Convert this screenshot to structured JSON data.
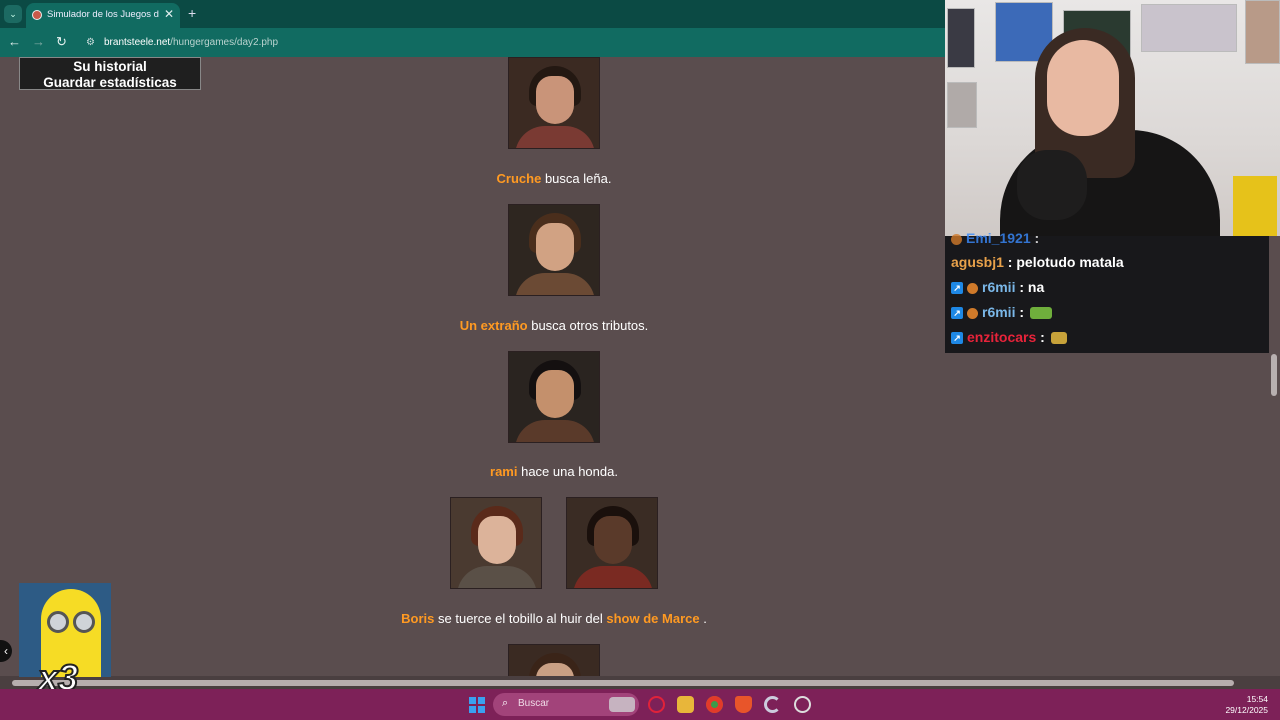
{
  "browser": {
    "tab_title": "Simulador de los Juegos del Ha",
    "tab_close": "✕",
    "new_tab": "+",
    "url_host": "brantsteele.net",
    "url_path": "/hungergames/day2.php"
  },
  "page": {
    "history_button": "Su historial",
    "stats_button": "Guardar estadísticas",
    "events": [
      {
        "name": "Cruche",
        "text": " busca leña."
      },
      {
        "name": "Un extraño",
        "text": " busca otros tributos."
      },
      {
        "name": "rami",
        "text": " hace una honda."
      },
      {
        "name": "Boris",
        "text": " se tuerce el tobillo al huir del ",
        "name2": "show de Marce",
        "text2": " ."
      }
    ]
  },
  "chat": {
    "messages": [
      {
        "user": "Emi_1921",
        "sep": " :",
        "message": ""
      },
      {
        "user": "agusbj1",
        "sep": " : ",
        "message": "pelotudo matala",
        "color": "#e8a14a"
      },
      {
        "user": "r6mii",
        "sep": " : ",
        "message": "na",
        "color": "#7ab7e8"
      },
      {
        "user": "r6mii",
        "sep": " : ",
        "message": "",
        "color": "#7ab7e8"
      },
      {
        "user": "enzitocars",
        "sep": " : ",
        "message": "",
        "color": "#e8233a"
      }
    ]
  },
  "overlay": {
    "multiplier": "x3"
  },
  "taskbar": {
    "search_placeholder": "Buscar",
    "time": "15:54",
    "date": "29/12/2025"
  },
  "colors": {
    "page_bg": "#5a4d4e",
    "name_orange": "#ff9a22",
    "browser_teal": "#116b61",
    "taskbar": "#7d2158"
  }
}
